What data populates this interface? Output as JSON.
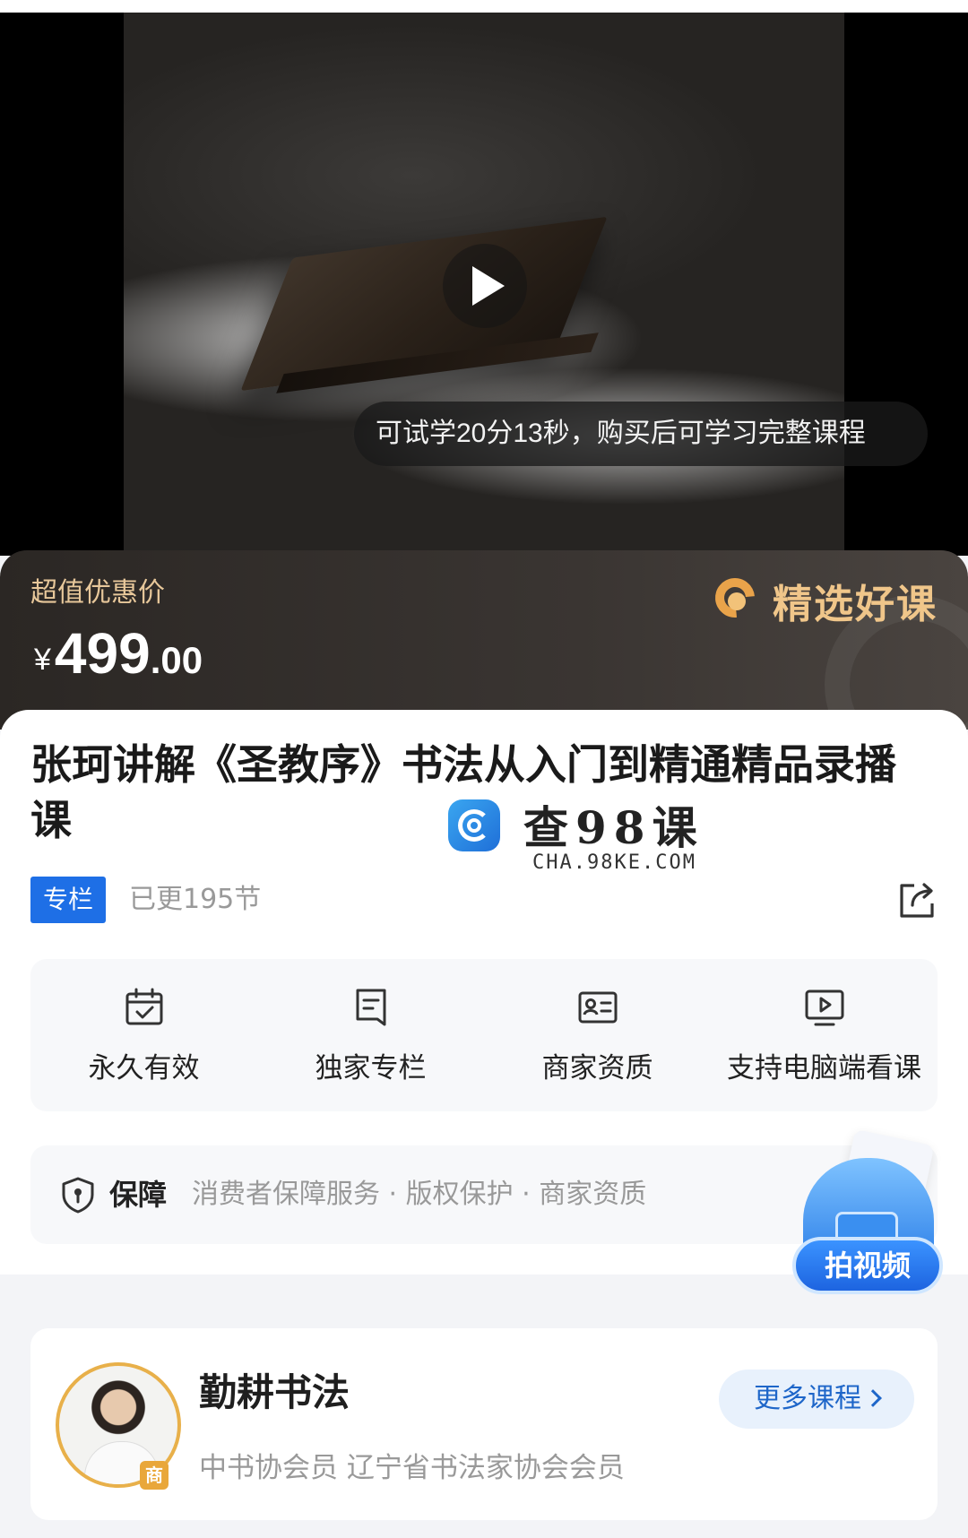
{
  "video": {
    "trial_notice": "可试学20分13秒，购买后可学习完整课程"
  },
  "price_banner": {
    "label": "超值优惠价",
    "currency": "¥",
    "price_integer": "499",
    "price_decimal": ".00",
    "badge": "精选好课",
    "colors": {
      "label": "#e7c79a",
      "badge": "#f0c68a"
    }
  },
  "course": {
    "title": "张珂讲解《圣教序》书法从入门到精通精品录播课",
    "tag": "专栏",
    "updated": "已更195节",
    "accent_color": "#1e6fe6"
  },
  "watermark": {
    "text": "查98课",
    "sub": "CHA.98KE.COM"
  },
  "features": [
    {
      "icon": "calendar-check-icon",
      "label": "永久有效"
    },
    {
      "icon": "document-icon",
      "label": "独家专栏"
    },
    {
      "icon": "id-card-icon",
      "label": "商家资质"
    },
    {
      "icon": "monitor-play-icon",
      "label": "支持电脑端看课"
    }
  ],
  "guarantee": {
    "title": "保障",
    "items": "消费者保障服务 · 版权保护 · 商家资质"
  },
  "float_button": {
    "label": "拍视频"
  },
  "author": {
    "name": "勤耕书法",
    "description": "中书协会员 辽宁省书法家协会会员",
    "more_courses": "更多课程",
    "merchant_badge": "商"
  }
}
